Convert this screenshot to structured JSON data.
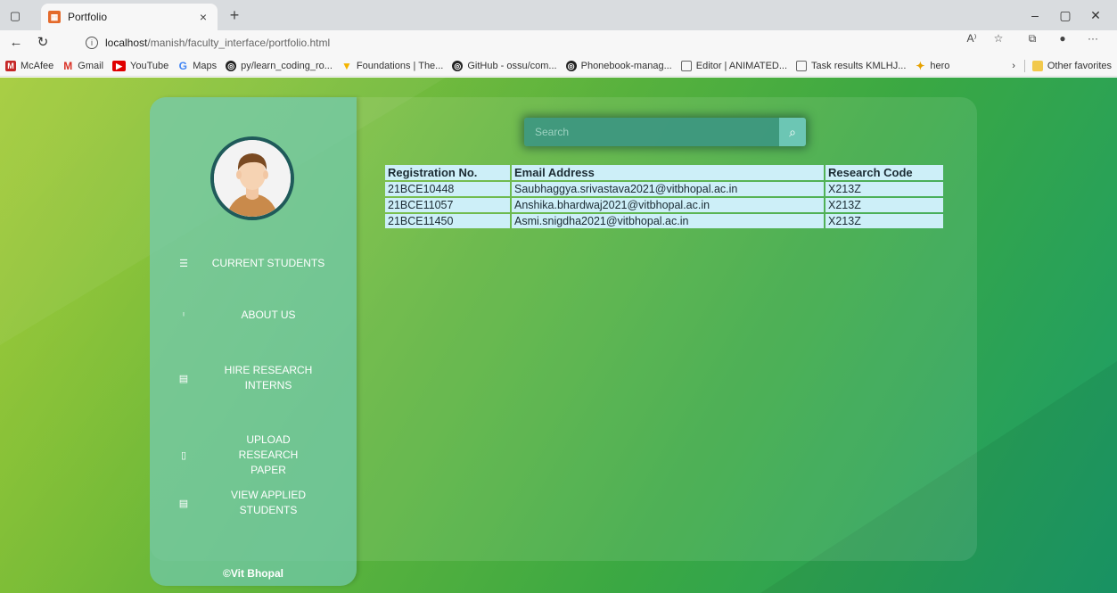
{
  "browser": {
    "tab_title": "Portfolio",
    "tab_close": "×",
    "new_tab": "+",
    "url_host": "localhost",
    "url_path": "/manish/faculty_interface/portfolio.html",
    "bookmarks": [
      {
        "label": "McAfee",
        "icon": "mcafee-icon",
        "color": "#c62828"
      },
      {
        "label": "Gmail",
        "icon": "gmail-icon",
        "color": "#d93025"
      },
      {
        "label": "YouTube",
        "icon": "youtube-icon",
        "color": "#e00000"
      },
      {
        "label": "Maps",
        "icon": "maps-icon",
        "color": "#4285f4"
      },
      {
        "label": "py/learn_coding_ro...",
        "icon": "github-icon",
        "color": "#222222"
      },
      {
        "label": "Foundations | The...",
        "icon": "foundations-icon",
        "color": "#f4b400"
      },
      {
        "label": "GitHub - ossu/com...",
        "icon": "github-icon",
        "color": "#222222"
      },
      {
        "label": "Phonebook-manag...",
        "icon": "github-icon",
        "color": "#222222"
      },
      {
        "label": "Editor | ANIMATED...",
        "icon": "page-icon",
        "color": "#777777"
      },
      {
        "label": "Task results KMLHJ...",
        "icon": "page-icon",
        "color": "#777777"
      },
      {
        "label": "hero",
        "icon": "hero-icon",
        "color": "#e6a100"
      }
    ],
    "other_favorites": "Other favorites"
  },
  "sidebar": {
    "nav": [
      {
        "label": "CURRENT STUDENTS",
        "icon": "list-icon"
      },
      {
        "label": "ABOUT US",
        "icon": "info-icon"
      },
      {
        "label": "HIRE RESEARCH INTERNS",
        "icon": "id-card-icon"
      },
      {
        "label": "UPLOAD RESEARCH PAPER",
        "icon": "upload-icon"
      },
      {
        "label": "VIEW APPLIED STUDENTS",
        "icon": "id-card-icon"
      }
    ],
    "footer": "©Vit Bhopal"
  },
  "search": {
    "placeholder": "Search"
  },
  "table": {
    "headers": [
      "Registration No.",
      "Email Address",
      "Research Code"
    ],
    "rows": [
      [
        "21BCE10448",
        "Saubhaggya.srivastava2021@vitbhopal.ac.in",
        "X213Z"
      ],
      [
        "21BCE11057",
        "Anshika.bhardwaj2021@vitbhopal.ac.in",
        "X213Z"
      ],
      [
        "21BCE11450",
        "Asmi.snigdha2021@vitbhopal.ac.in",
        "X213Z"
      ]
    ]
  },
  "colors": {
    "sidebar": "#70c8aa",
    "table_cell": "#cdeff8",
    "page_gradient_start": "#9ec82b",
    "page_gradient_end": "#1a9c6a"
  }
}
